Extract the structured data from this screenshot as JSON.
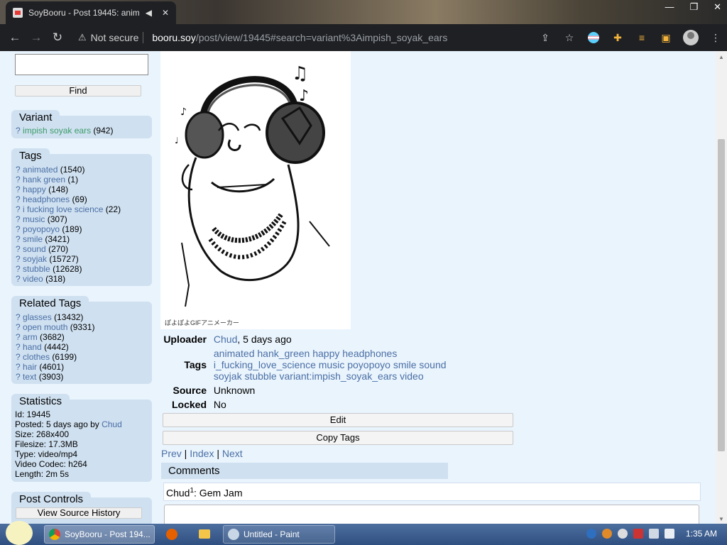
{
  "browser": {
    "tab_title": "SoyBooru - Post 19445: anim",
    "not_secure": "Not secure",
    "url_domain": "booru.soy",
    "url_path": "/post/view/19445#search=variant%3Aimpish_soyak_ears"
  },
  "sidebar": {
    "find_label": "Find",
    "variant": {
      "title": "Variant",
      "items": [
        {
          "q": "?",
          "name": "impish soyak ears",
          "count": "(942)"
        }
      ]
    },
    "tags": {
      "title": "Tags",
      "items": [
        {
          "q": "?",
          "name": "animated",
          "count": "(1540)"
        },
        {
          "q": "?",
          "name": "hank green",
          "count": "(1)"
        },
        {
          "q": "?",
          "name": "happy",
          "count": "(148)"
        },
        {
          "q": "?",
          "name": "headphones",
          "count": "(69)"
        },
        {
          "q": "?",
          "name": "i fucking love science",
          "count": "(22)"
        },
        {
          "q": "?",
          "name": "music",
          "count": "(307)"
        },
        {
          "q": "?",
          "name": "poyopoyo",
          "count": "(189)"
        },
        {
          "q": "?",
          "name": "smile",
          "count": "(3421)"
        },
        {
          "q": "?",
          "name": "sound",
          "count": "(270)"
        },
        {
          "q": "?",
          "name": "soyjak",
          "count": "(15727)"
        },
        {
          "q": "?",
          "name": "stubble",
          "count": "(12628)"
        },
        {
          "q": "?",
          "name": "video",
          "count": "(318)"
        }
      ]
    },
    "related": {
      "title": "Related Tags",
      "items": [
        {
          "q": "?",
          "name": "glasses",
          "count": "(13432)"
        },
        {
          "q": "?",
          "name": "open mouth",
          "count": "(9331)"
        },
        {
          "q": "?",
          "name": "arm",
          "count": "(3682)"
        },
        {
          "q": "?",
          "name": "hand",
          "count": "(4442)"
        },
        {
          "q": "?",
          "name": "clothes",
          "count": "(6199)"
        },
        {
          "q": "?",
          "name": "hair",
          "count": "(4601)"
        },
        {
          "q": "?",
          "name": "text",
          "count": "(3903)"
        }
      ]
    },
    "stats": {
      "title": "Statistics",
      "id": "Id: 19445",
      "posted_prefix": "Posted: 5 days ago by ",
      "posted_user": "Chud",
      "size": "Size: 268x400",
      "filesize": "Filesize: 17.3MB",
      "type": "Type: video/mp4",
      "codec": "Video Codec: h264",
      "length": "Length: 2m 5s"
    },
    "controls": {
      "title": "Post Controls",
      "history": "View Source History"
    }
  },
  "post": {
    "image_caption": "ぽよぽよGIFアニメーカー",
    "uploader_label": "Uploader",
    "uploader_name": "Chud",
    "uploader_time": ", 5 days ago",
    "tags_label": "Tags",
    "tags_line1": "animated hank_green happy headphones",
    "tags_line2": "i_fucking_love_science music poyopoyo smile sound",
    "tags_line3": "soyjak stubble variant:impish_soyak_ears video",
    "source_label": "Source",
    "source_value": "Unknown",
    "locked_label": "Locked",
    "locked_value": "No",
    "edit": "Edit",
    "copy_tags": "Copy Tags",
    "prev": "Prev",
    "index": "Index",
    "next": "Next",
    "sep": " | "
  },
  "comments": {
    "title": "Comments",
    "author": "Chud",
    "sup": "1",
    "text": ": Gem Jam"
  },
  "taskbar": {
    "item1": "SoyBooru - Post 194...",
    "item2": "Untitled - Paint",
    "time": "1:35 AM"
  }
}
